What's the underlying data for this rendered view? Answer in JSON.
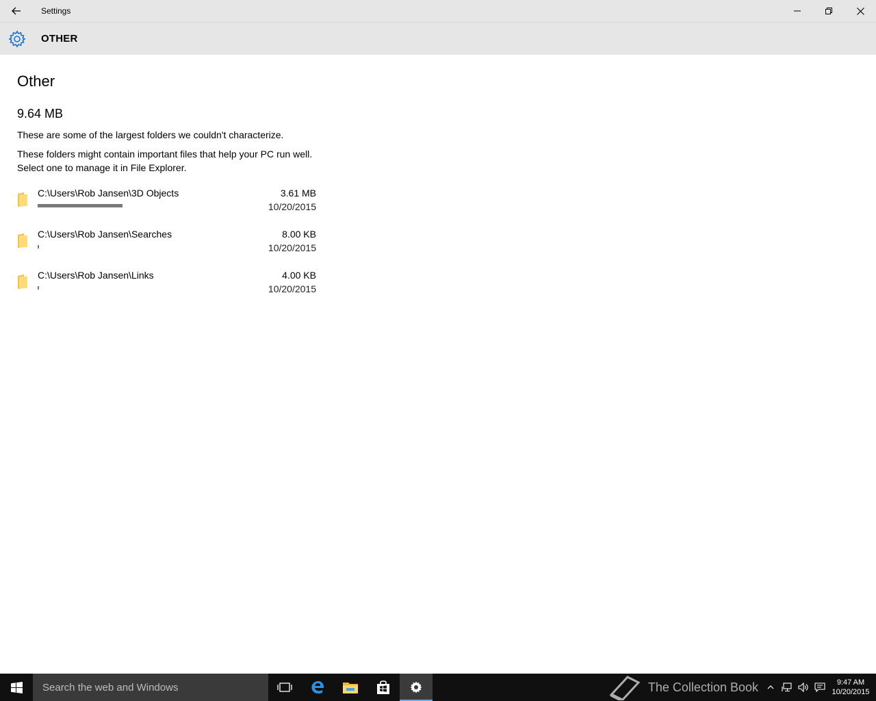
{
  "window": {
    "title": "Settings"
  },
  "header": {
    "section": "OTHER"
  },
  "main": {
    "title": "Other",
    "total_size": "9.64 MB",
    "description1": "These are some of the largest folders we couldn't characterize.",
    "description2": "These folders might contain important files that help your PC run well. Select one to manage it in File Explorer.",
    "folders": [
      {
        "path": "C:\\Users\\Rob Jansen\\3D Objects",
        "size": "3.61 MB",
        "date": "10/20/2015",
        "usage_fraction": 0.62
      },
      {
        "path": "C:\\Users\\Rob Jansen\\Searches",
        "size": "8.00 KB",
        "date": "10/20/2015",
        "usage_fraction": 0.01
      },
      {
        "path": "C:\\Users\\Rob Jansen\\Links",
        "size": "4.00 KB",
        "date": "10/20/2015",
        "usage_fraction": 0.01
      }
    ]
  },
  "taskbar": {
    "search_placeholder": "Search the web and Windows",
    "watermark": "The Collection Book",
    "clock_time": "9:47 AM",
    "clock_date": "10/20/2015"
  },
  "colors": {
    "accent": "#1e73c8",
    "chrome": "#e6e6e6",
    "bar": "#7a7a7a",
    "taskbar": "#101010"
  },
  "icons": {
    "back": "back-arrow-icon",
    "minimize": "minimize-icon",
    "maximize": "restore-icon",
    "close": "close-icon",
    "gear": "gear-icon",
    "folder": "folder-icon",
    "start": "windows-logo-icon"
  }
}
